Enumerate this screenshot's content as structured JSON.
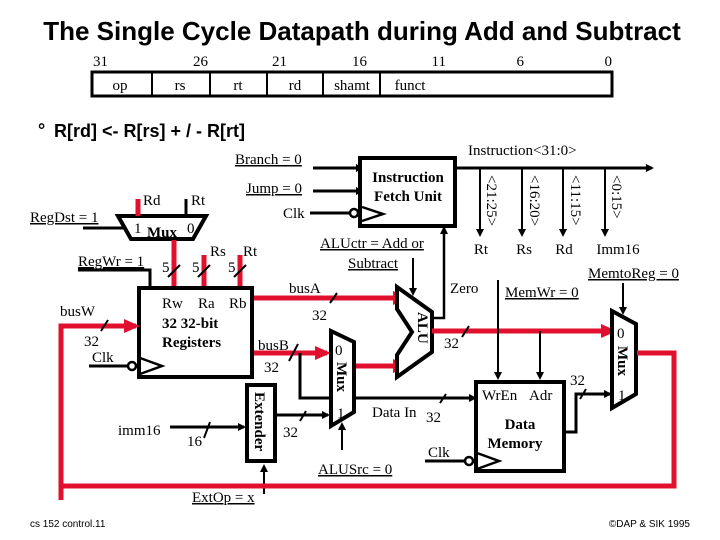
{
  "title": "The Single Cycle Datapath during Add and Subtract",
  "instruction_format": {
    "bit_labels": [
      "31",
      "26",
      "21",
      "16",
      "11",
      "6",
      "0"
    ],
    "fields": [
      "op",
      "rs",
      "rt",
      "rd",
      "shamt",
      "funct"
    ]
  },
  "equation": {
    "bullet": "°",
    "text": "R[rd]  <-  R[rs]  + / -  R[rt]"
  },
  "control_signals": {
    "branch": "Branch = 0",
    "jump": "Jump = 0",
    "regdst": "RegDst = 1",
    "regwr": "RegWr = 1",
    "aluctr_line1": "ALUctr = Add or",
    "aluctr_line2": "Subtract",
    "memwr": "MemWr = 0",
    "memtoreg": "MemtoReg = 0",
    "alusrc": "ALUSrc = 0",
    "extop": "ExtOp = x"
  },
  "ifu": {
    "line1": "Instruction",
    "line2": "Fetch Unit",
    "clk": "Clk",
    "instruction_bus": "Instruction<31:0>",
    "taps": [
      {
        "range": "<21:25>",
        "name": "Rt"
      },
      {
        "range": "<16:20>",
        "name": "Rs"
      },
      {
        "range": "<11:15>",
        "name": "Rd"
      },
      {
        "range": "<0:15>",
        "name": "Imm16"
      }
    ]
  },
  "regdst_mux": {
    "in1_label": "Rd",
    "in0_label": "Rt",
    "sel1": "1",
    "name": "Mux",
    "sel0": "0"
  },
  "register_file": {
    "width_rw": "5",
    "width_ra": "5",
    "width_rb": "5",
    "rs_label": "Rs",
    "rt_label": "Rt",
    "port_rw": "Rw",
    "port_ra": "Ra",
    "port_rb": "Rb",
    "line1": "32 32-bit",
    "line2": "Registers",
    "clk": "Clk",
    "busw": "busW",
    "busw_width": "32",
    "busa": "busA",
    "busa_width": "32",
    "busb": "busB",
    "busb_width": "32"
  },
  "extender": {
    "name": "Extender",
    "input": "imm16",
    "input_width": "16",
    "output_width": "32"
  },
  "alusrc_mux": {
    "sel0": "0",
    "name": "Mux",
    "sel1": "1"
  },
  "alu": {
    "name": "ALU",
    "zero": "Zero",
    "out_width": "32"
  },
  "data_memory": {
    "wren": "WrEn",
    "adr": "Adr",
    "line1": "Data",
    "line2": "Memory",
    "data_in": "Data In",
    "data_in_width": "32",
    "clk": "Clk",
    "out_width": "32"
  },
  "memtoreg_mux": {
    "sel0": "0",
    "name": "Mux",
    "sel1": "1"
  },
  "colors": {
    "active_path": "#e0102e",
    "wire": "#000000"
  },
  "footer": {
    "left": "cs 152  control.11",
    "right": "©DAP & SIK 1995"
  }
}
